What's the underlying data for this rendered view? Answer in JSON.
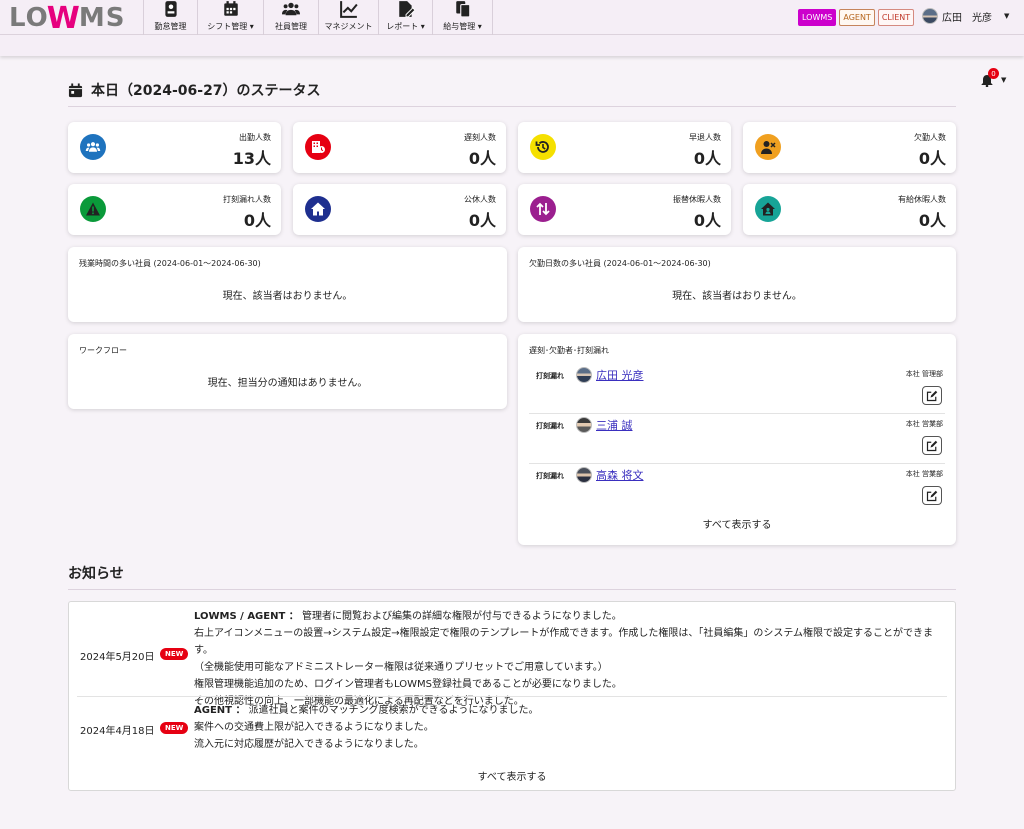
{
  "logo": {
    "lo": "LO",
    "w": "W",
    "ms": "MS"
  },
  "nav": [
    {
      "label": "勤怠管理",
      "icon": "id-card-icon",
      "caret": false
    },
    {
      "label": "シフト管理",
      "icon": "calendar-icon",
      "caret": true
    },
    {
      "label": "社員管理",
      "icon": "users-icon",
      "caret": false
    },
    {
      "label": "マネジメント",
      "icon": "chart-line-icon",
      "caret": false
    },
    {
      "label": "レポート",
      "icon": "file-edit-icon",
      "caret": true
    },
    {
      "label": "給与管理",
      "icon": "copy-icon",
      "caret": true
    }
  ],
  "tags": {
    "lowms": "LOWMS",
    "agent": "AGENT",
    "client": "CLIENT"
  },
  "user": {
    "name": "広田　光彦"
  },
  "notifications": {
    "count": "0"
  },
  "status": {
    "title": "本日（2024-06-27）のステータス",
    "cards": [
      {
        "label": "出勤人数",
        "value": "13人",
        "icon": "users-icon",
        "color": "#1e73be"
      },
      {
        "label": "遅刻人数",
        "value": "0人",
        "icon": "building-clock-icon",
        "color": "#e60012"
      },
      {
        "label": "早退人数",
        "value": "0人",
        "icon": "history-icon",
        "color": "#f5e000"
      },
      {
        "label": "欠勤人数",
        "value": "0人",
        "icon": "user-x-icon",
        "color": "#f0a020"
      },
      {
        "label": "打刻漏れ人数",
        "value": "0人",
        "icon": "warning-icon",
        "color": "#0a9a3a"
      },
      {
        "label": "公休人数",
        "value": "0人",
        "icon": "home-icon",
        "color": "#1e2f8f"
      },
      {
        "label": "振替休暇人数",
        "value": "0人",
        "icon": "swap-icon",
        "color": "#9b1f8f"
      },
      {
        "label": "有給休暇人数",
        "value": "0人",
        "icon": "house-user-icon",
        "color": "#17a497"
      }
    ]
  },
  "overtime": {
    "title": "残業時間の多い社員 (2024-06-01〜2024-06-30)",
    "empty": "現在、該当者はおりません。"
  },
  "absence": {
    "title": "欠勤日数の多い社員 (2024-06-01〜2024-06-30)",
    "empty": "現在、該当者はおりません。"
  },
  "workflow": {
    "title": "ワークフロー",
    "empty": "現在、担当分の通知はありません。"
  },
  "late": {
    "title": "遅刻･欠勤者･打刻漏れ",
    "rows": [
      {
        "kind": "打刻漏れ",
        "name": "広田 光彦",
        "dept": "本社 管理部"
      },
      {
        "kind": "打刻漏れ",
        "name": "三浦 誠",
        "dept": "本社 営業部"
      },
      {
        "kind": "打刻漏れ",
        "name": "高森 将文",
        "dept": "本社 営業部"
      }
    ],
    "show_all": "すべて表示する"
  },
  "notices": {
    "title": "お知らせ",
    "items": [
      {
        "date": "2024年5月20日",
        "badge": "NEW",
        "lead": "LOWMS / AGENT ：",
        "lines": [
          "管理者に閲覧および編集の詳細な権限が付与できるようになりました。",
          "右上アイコンメニューの設置→システム設定→権限設定で権限のテンプレートが作成できます。作成した権限は、「社員編集」のシステム権限で設定することができます。",
          "（全機能使用可能なアドミニストレーター権限は従来通りプリセットでご用意しています。）",
          "権限管理機能追加のため、ログイン管理者もLOWMS登録社員であることが必要になりました。",
          "その他視認性の向上、一部機能の最適化による再配置などを行いました。"
        ]
      },
      {
        "date": "2024年4月18日",
        "badge": "NEW",
        "lead": "AGENT ：",
        "lines": [
          "派遣社員と案件のマッチング度検索ができるようになりました。",
          "案件への交通費上限が記入できるようになりました。",
          "流入元に対応履歴が記入できるようになりました。"
        ]
      }
    ],
    "show_all": "すべて表示する"
  }
}
